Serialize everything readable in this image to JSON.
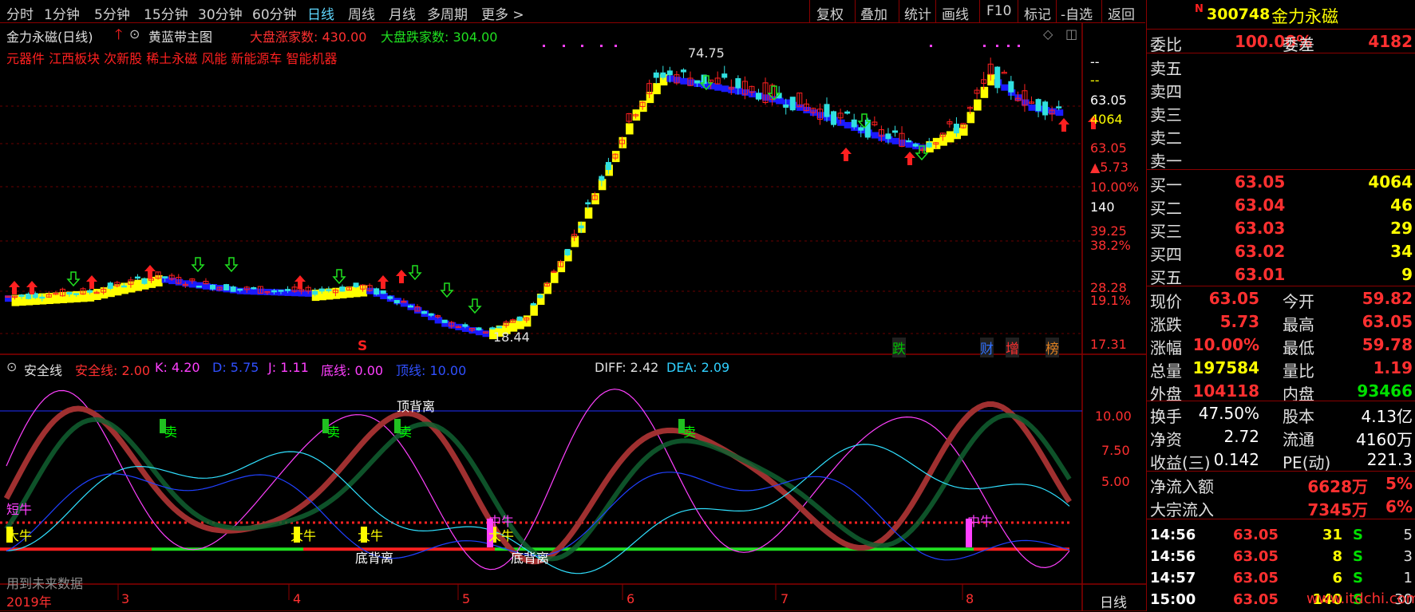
{
  "toolbar": {
    "periods": [
      "分时",
      "1分钟",
      "5分钟",
      "15分钟",
      "30分钟",
      "60分钟",
      "日线",
      "周线",
      "月线",
      "多周期",
      "更多 >"
    ],
    "active_index": 6,
    "tools": [
      "复权",
      "叠加",
      "统计",
      "画线",
      "F10",
      "标记",
      "-自选",
      "返回"
    ]
  },
  "main_chart": {
    "title": "金力永磁(日线)",
    "indicator_name": "黄蓝带主图",
    "adv_label": "大盘涨家数: 430.00",
    "dec_label": "大盘跌家数: 304.00",
    "sectors": "元器件 江西板块 次新股 稀土永磁 风能 新能源车 智能机器",
    "high_label": "74.75",
    "low_label": "18.44",
    "marker_s": "S",
    "badges": [
      {
        "text": "跌",
        "color": "#00c000"
      },
      {
        "text": "财",
        "color": "#3070ff"
      },
      {
        "text": "增",
        "color": "#ff3030"
      },
      {
        "text": "榜",
        "color": "#e08020"
      }
    ],
    "axis_labels": [
      {
        "text": "--",
        "color": "#ffffff"
      },
      {
        "text": "--",
        "color": "#ffff00"
      },
      {
        "text": "63.05",
        "color": "#ffffff"
      },
      {
        "text": "4064",
        "color": "#ffff00"
      },
      {
        "text": "63.05",
        "color": "#ff3030"
      },
      {
        "text": "▲5.73",
        "color": "#ff3030"
      },
      {
        "text": "10.00%",
        "color": "#ff3030"
      },
      {
        "text": "140",
        "color": "#ffffff"
      },
      {
        "text": "39.25",
        "color": "#ff3030"
      },
      {
        "text": "38.2%",
        "color": "#ff3030"
      },
      {
        "text": "28.28",
        "color": "#ff3030"
      },
      {
        "text": "19.1%",
        "color": "#ff3030"
      },
      {
        "text": "17.31",
        "color": "#ff3030"
      }
    ]
  },
  "sub_chart": {
    "name": "安全线",
    "params": [
      {
        "text": "安全线: 2.00",
        "color": "#ff3030"
      },
      {
        "text": "K: 4.20",
        "color": "#ff40ff"
      },
      {
        "text": "D: 5.75",
        "color": "#3050ff"
      },
      {
        "text": "J: 1.11",
        "color": "#ff40ff"
      },
      {
        "text": "底线: 0.00",
        "color": "#ff40ff"
      },
      {
        "text": "顶线: 10.00",
        "color": "#3050ff"
      }
    ],
    "diff": "DIFF: 2.42",
    "dea": "DEA: 2.09",
    "top_div": "顶背离",
    "bottom_div": "底背离",
    "sell": "卖",
    "big_bull": "大牛",
    "mid_bull": "中牛",
    "short_bull": "短牛",
    "future_note": "用到未来数据",
    "axis": [
      "10.00",
      "7.50",
      "5.00"
    ]
  },
  "date_axis": {
    "labels": [
      "2019年",
      "3",
      "4",
      "5",
      "6",
      "7",
      "8"
    ],
    "period": "日线"
  },
  "quote": {
    "badge": "N",
    "code": "300748",
    "name": "金力永磁",
    "weibi_label": "委比",
    "weibi_value": "100.00%",
    "weicha_label": "委差",
    "weicha_value": "4182",
    "sells": [
      "卖五",
      "卖四",
      "卖三",
      "卖二",
      "卖一"
    ],
    "buys": [
      {
        "label": "买一",
        "price": "63.05",
        "vol": "4064"
      },
      {
        "label": "买二",
        "price": "63.04",
        "vol": "46"
      },
      {
        "label": "买三",
        "price": "63.03",
        "vol": "29"
      },
      {
        "label": "买四",
        "price": "63.02",
        "vol": "34"
      },
      {
        "label": "买五",
        "price": "63.01",
        "vol": "9"
      }
    ],
    "stats": [
      {
        "l1": "现价",
        "v1": "63.05",
        "c1": "#ff3030",
        "l2": "今开",
        "v2": "59.82",
        "c2": "#ff3030"
      },
      {
        "l1": "涨跌",
        "v1": "5.73",
        "c1": "#ff3030",
        "l2": "最高",
        "v2": "63.05",
        "c2": "#ff3030"
      },
      {
        "l1": "涨幅",
        "v1": "10.00%",
        "c1": "#ff3030",
        "l2": "最低",
        "v2": "59.78",
        "c2": "#ff3030"
      },
      {
        "l1": "总量",
        "v1": "197584",
        "c1": "#ffff00",
        "l2": "量比",
        "v2": "1.19",
        "c2": "#ff3030"
      },
      {
        "l1": "外盘",
        "v1": "104118",
        "c1": "#ff3030",
        "l2": "内盘",
        "v2": "93466",
        "c2": "#00e000"
      }
    ],
    "stats2": [
      {
        "l1": "换手",
        "v1": "47.50%",
        "c1": "#ffffff",
        "l2": "股本",
        "v2": "4.13亿",
        "c2": "#ffffff"
      },
      {
        "l1": "净资",
        "v1": "2.72",
        "c1": "#ffffff",
        "l2": "流通",
        "v2": "4160万",
        "c2": "#ffffff"
      },
      {
        "l1": "收益(三)",
        "v1": "0.142",
        "c1": "#ffffff",
        "l2": "PE(动)",
        "v2": "221.3",
        "c2": "#ffffff"
      }
    ],
    "flows": [
      {
        "label": "净流入额",
        "value": "6628万",
        "pct": "5%"
      },
      {
        "label": "大宗流入",
        "value": "7345万",
        "pct": "6%"
      }
    ],
    "ticks": [
      {
        "time": "14:56",
        "price": "63.05",
        "vol": "31",
        "side": "S",
        "n": "5"
      },
      {
        "time": "14:56",
        "price": "63.05",
        "vol": "8",
        "side": "S",
        "n": "3"
      },
      {
        "time": "14:57",
        "price": "63.05",
        "vol": "6",
        "side": "S",
        "n": "1"
      },
      {
        "time": "15:00",
        "price": "63.05",
        "vol": "140",
        "side": "S",
        "n": "30"
      }
    ],
    "watermark": "www.itdchi.com"
  }
}
